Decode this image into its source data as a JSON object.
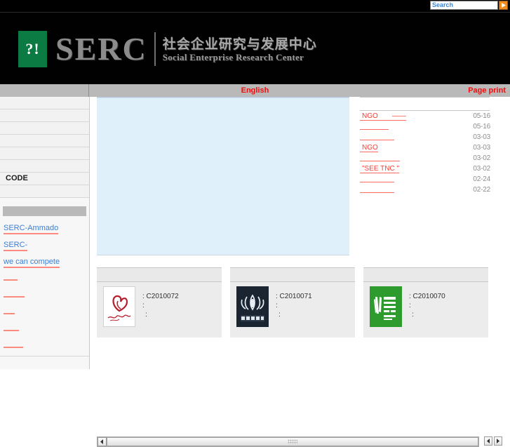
{
  "topbar": {
    "search_placeholder": "Search",
    "search_value": "",
    "search_button_icon": "chevron-right-icon"
  },
  "masthead": {
    "logo_mark": "?!",
    "logo_acronym": "SERC",
    "title_cn": "社会企业研究与发展中心",
    "title_en": "Social Enterprise Research Center"
  },
  "nav": {
    "english": "English",
    "page_print": "Page print"
  },
  "sidebar": {
    "menu": [
      "",
      "",
      "",
      "",
      "",
      "",
      "CODE",
      ""
    ],
    "links": [
      {
        "label": "SERC-Ammado",
        "blank": false
      },
      {
        "label": "SERC-",
        "blank": false
      },
      {
        "label": "we can compete",
        "blank": false
      },
      {
        "label": "",
        "blank": true,
        "width": "w20"
      },
      {
        "label": "",
        "blank": true,
        "width": "w30"
      },
      {
        "label": "",
        "blank": true,
        "width": "w16"
      },
      {
        "label": "",
        "blank": true,
        "width": "w22"
      },
      {
        "label": "",
        "blank": true,
        "width": "w28"
      }
    ]
  },
  "news": {
    "items": [
      {
        "title": "NGO　　——",
        "date": "05-16",
        "blank": false
      },
      {
        "title": "",
        "date": "05-16",
        "blank": true,
        "width": "nw38"
      },
      {
        "title": "",
        "date": "03-03",
        "blank": true,
        "width": "nw46"
      },
      {
        "title": "NGO",
        "date": "03-03",
        "blank": false
      },
      {
        "title": "",
        "date": "03-02",
        "blank": true,
        "width": "nw54"
      },
      {
        "title": "\"SEE TNC  \"",
        "date": "03-02",
        "blank": false
      },
      {
        "title": "",
        "date": "02-24",
        "blank": true,
        "width": "nw46"
      },
      {
        "title": "",
        "date": "02-22",
        "blank": true,
        "width": "nw46"
      }
    ]
  },
  "cards": [
    {
      "logo_style": "white",
      "logo_alt": "hongfuhui-heart-logo",
      "code_line": ": C2010072",
      "line2": ":",
      "line3": ":"
    },
    {
      "logo_style": "navy",
      "logo_alt": "dark-emblem-logo",
      "code_line": ": C2010071",
      "line2": ":",
      "line3": ":"
    },
    {
      "logo_style": "green",
      "logo_alt": "green-seal-logo",
      "code_line": ": C2010070",
      "line2": ":",
      "line3": ":"
    }
  ],
  "scrollbar": {
    "left_arrow": "◀",
    "right_arrow": "▶",
    "extra_left_arrow": "◀",
    "extra_right_arrow": "▶"
  },
  "colors": {
    "accent_red": "#f50b0b",
    "link_blue": "#3a7fd5",
    "brand_green": "#0b7a43",
    "search_orange": "#f08b22",
    "banner_blue": "#e0f0fb"
  }
}
